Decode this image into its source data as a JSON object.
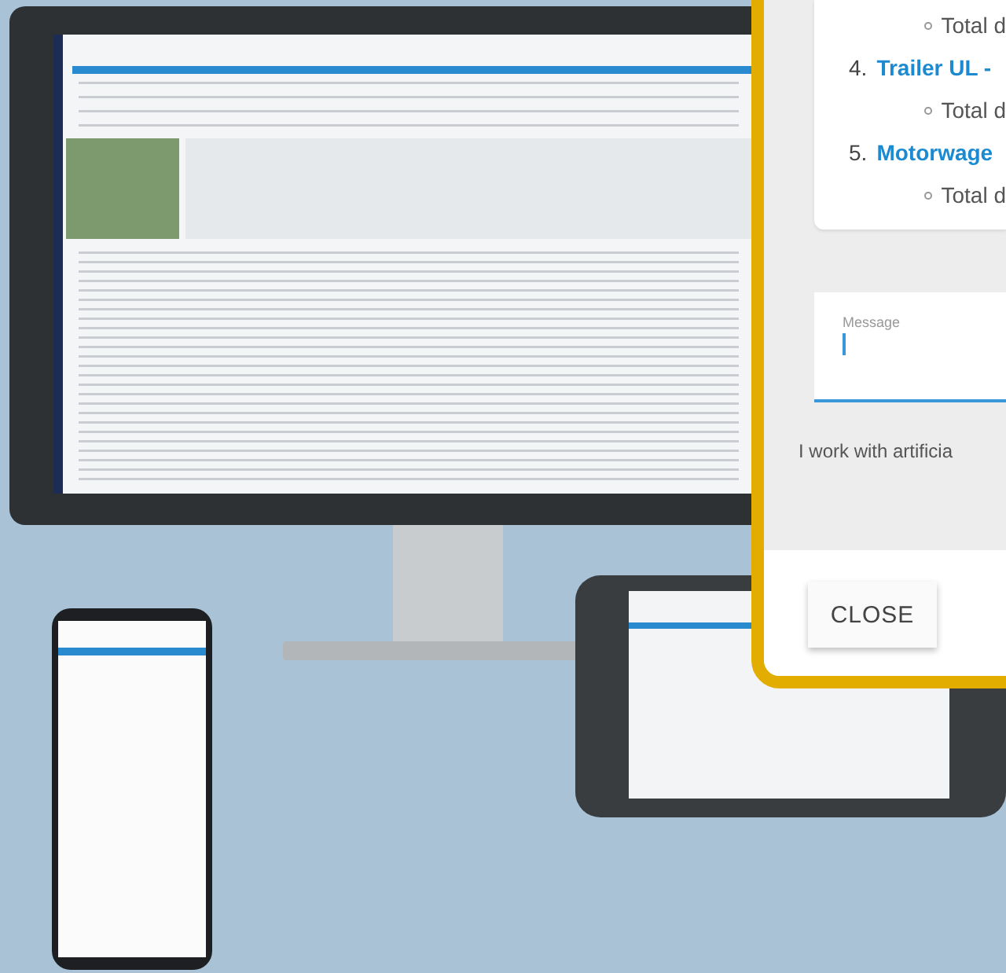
{
  "chat_dialog": {
    "message_items": [
      {
        "kind": "detail",
        "text": "Total d"
      },
      {
        "kind": "link",
        "number": "4.",
        "text": "Trailer UL -"
      },
      {
        "kind": "detail",
        "text": "Total d"
      },
      {
        "kind": "link",
        "number": "5.",
        "text": "Motorwage"
      },
      {
        "kind": "detail",
        "text": "Total d"
      }
    ],
    "message_field": {
      "label": "Message"
    },
    "disclaimer": "I work with artificia",
    "buttons": [
      "CLOSE"
    ]
  }
}
